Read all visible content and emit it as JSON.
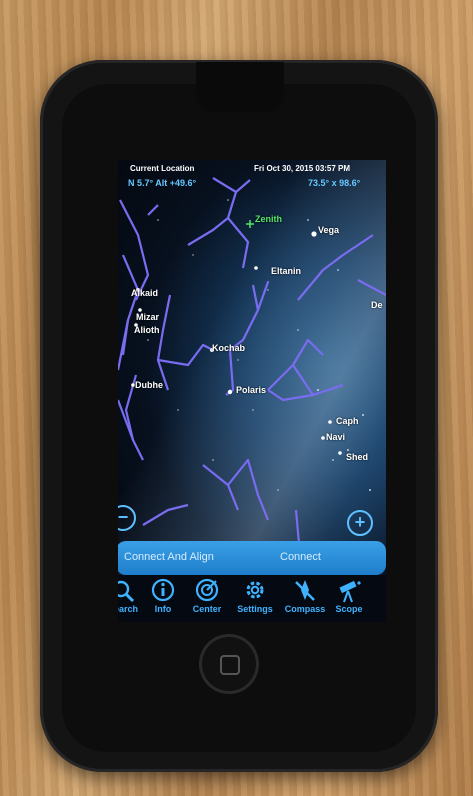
{
  "status_bar": {
    "location": "Current Location",
    "datetime": "Fri Oct 30, 2015  03:57 PM"
  },
  "readouts": {
    "position": "N 5.7° Alt +49.6°",
    "fov": "73.5° x 98.6°"
  },
  "stars": {
    "zenith": "Zenith",
    "vega": "Vega",
    "eltanin": "Eltanin",
    "alkaid": "Alkaid",
    "mizar": "Mizar",
    "alioth": "Alioth",
    "kochab": "Kochab",
    "dubhe": "Dubhe",
    "polaris": "Polaris",
    "caph": "Caph",
    "navi": "Navi",
    "shedar": "Shed",
    "deneb": "De"
  },
  "zoom": {
    "out": "−",
    "in": "+"
  },
  "connect": {
    "align_label": "Connect And Align",
    "connect_label": "Connect"
  },
  "tabs": [
    {
      "label": "Search",
      "icon": "search-icon"
    },
    {
      "label": "Info",
      "icon": "info-icon"
    },
    {
      "label": "Center",
      "icon": "target-icon"
    },
    {
      "label": "Settings",
      "icon": "gear-icon"
    },
    {
      "label": "Compass",
      "icon": "compass-icon"
    },
    {
      "label": "Scope",
      "icon": "telescope-icon"
    }
  ],
  "colors": {
    "constellation": "#7a6cf0",
    "accent": "#3fb2ff",
    "zenith": "#55e46a"
  }
}
